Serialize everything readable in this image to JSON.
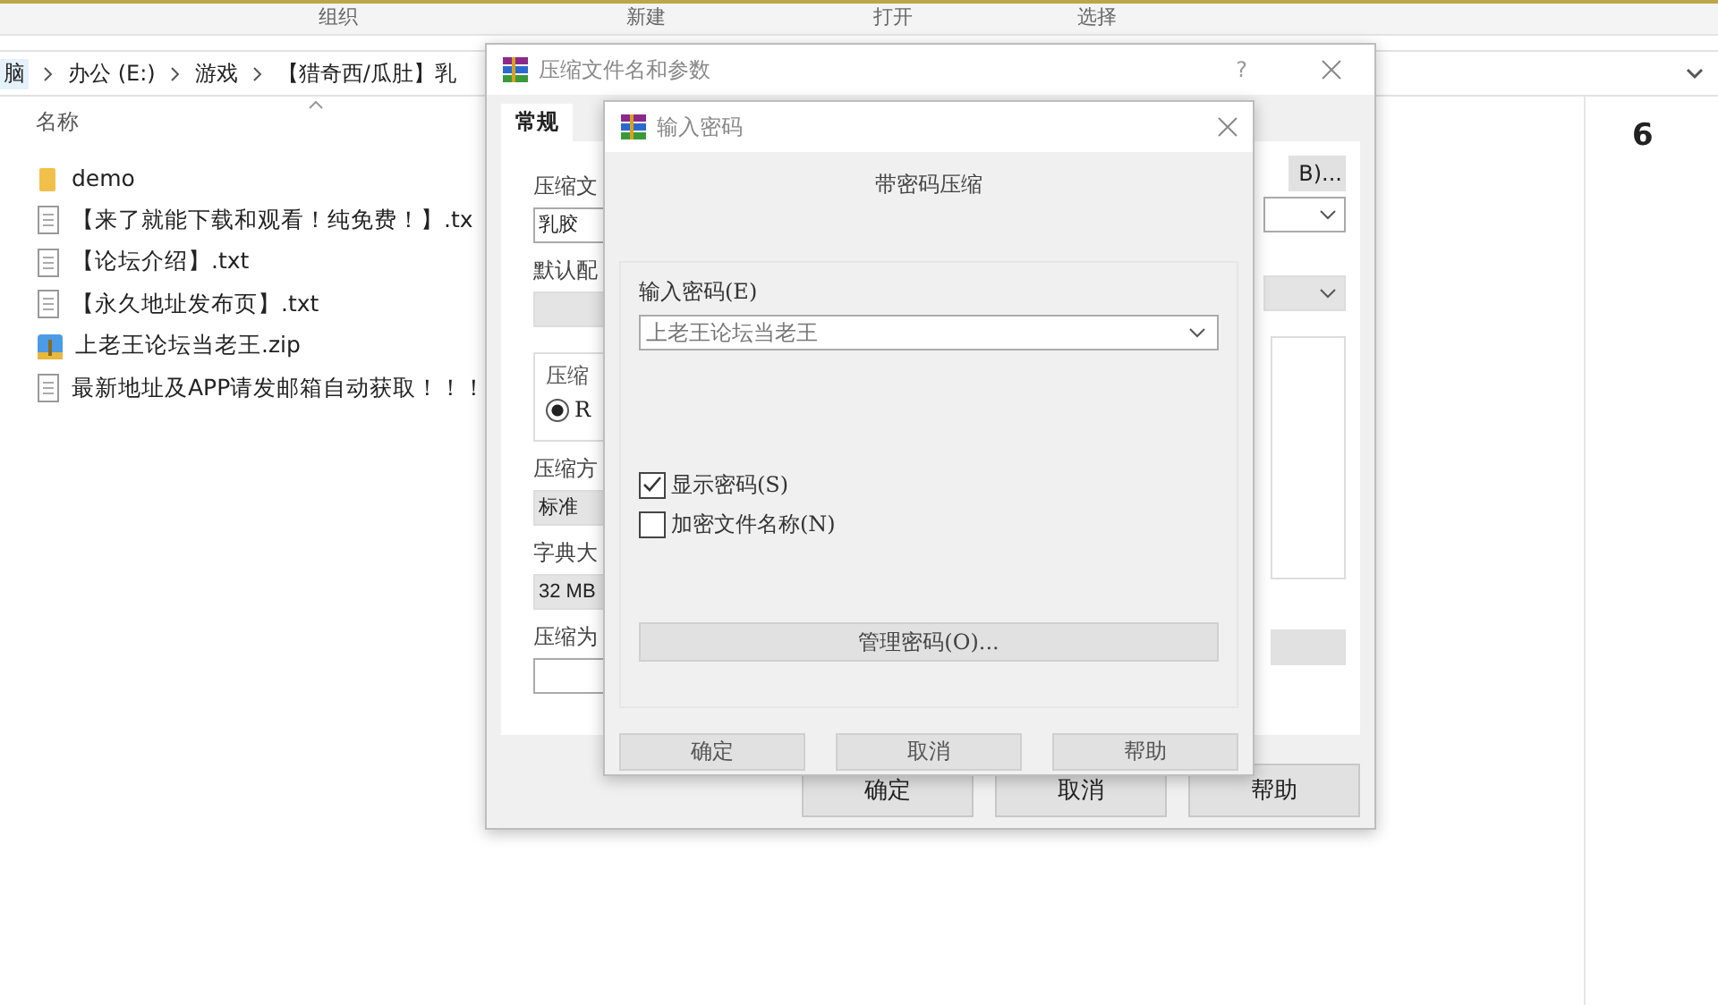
{
  "ribbon_groups": [
    "组织",
    "新建",
    "打开",
    "选择"
  ],
  "address_bar": {
    "crumbs": [
      "脑",
      "办公 (E:)",
      "游戏",
      "【猎奇西/瓜肚】乳"
    ]
  },
  "file_list": {
    "column": "名称",
    "files": [
      {
        "name": "demo",
        "kind": "folder"
      },
      {
        "name": "【来了就能下载和观看！纯免费！】.tx",
        "kind": "text"
      },
      {
        "name": "【论坛介绍】.txt",
        "kind": "text"
      },
      {
        "name": "【永久地址发布页】.txt",
        "kind": "text"
      },
      {
        "name": "上老王论坛当老王.zip",
        "kind": "archive"
      },
      {
        "name": "最新地址及APP请发邮箱自动获取！！！",
        "kind": "text"
      }
    ]
  },
  "details_pane": {
    "text": "6"
  },
  "archive_dialog": {
    "title": "压缩文件名和参数",
    "help": "?",
    "tabs": [
      {
        "label": "常规",
        "selected": true
      }
    ],
    "name_label": "压缩文",
    "name_value": "乳胶",
    "browse_button": "B)...",
    "profile_label": "默认配",
    "format_label": "压缩",
    "format_radio": {
      "label": "R",
      "checked": true
    },
    "method_label": "压缩方",
    "method_value": "标准",
    "dict_label": "字典大",
    "dict_value": "32 MB",
    "split_label": "压缩为",
    "buttons": [
      "确定",
      "取消",
      "帮助"
    ]
  },
  "password_dialog": {
    "title": "输入密码",
    "heading": "带密码压缩",
    "field_label": "输入密码(E)",
    "password": "上老王论坛当老王",
    "options": [
      {
        "label": "显示密码(S)",
        "checked": true
      },
      {
        "label": "加密文件名称(N)",
        "checked": false
      }
    ],
    "manage_button": "管理密码(O)...",
    "buttons": [
      "确定",
      "取消",
      "帮助"
    ]
  }
}
